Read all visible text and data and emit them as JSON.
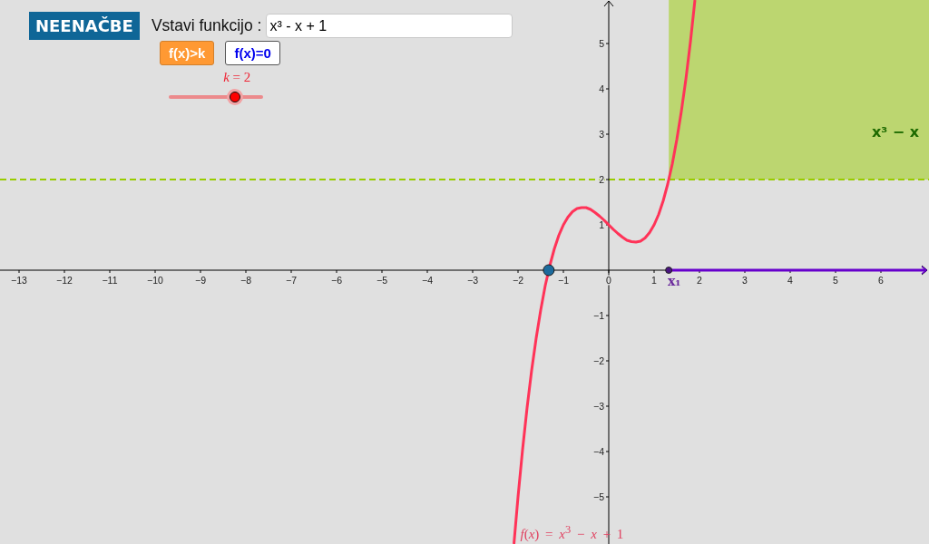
{
  "header": {
    "title": "NEENAČBE",
    "input_label": "Vstavi funkcijo :",
    "input_value": "x³ - x + 1"
  },
  "buttons": [
    {
      "label": "f(x)>k",
      "selected": true
    },
    {
      "label": "f(x)=0",
      "selected": false
    }
  ],
  "slider": {
    "label": "*k* = 2",
    "level": 0.7
  },
  "graph": {
    "chart_data": {
      "type": "line",
      "x": [
        -2.09,
        -2.0,
        -1.9,
        -1.8,
        -1.7,
        -1.6,
        -1.5,
        -1.4,
        -1.3,
        -1.2,
        -1.1,
        -1.0,
        -0.9,
        -0.8,
        -0.7,
        -0.6,
        -0.5,
        -0.4,
        -0.3,
        -0.2,
        -0.1,
        0,
        0.1,
        0.2,
        0.3,
        0.4,
        0.5,
        0.6,
        0.7,
        0.8,
        0.9,
        1.0,
        1.1,
        1.2,
        1.3,
        1.4,
        1.5,
        1.6,
        1.7,
        1.8,
        1.9
      ],
      "series": [
        {
          "name": "*f*(*x*) = *x*$^{3}$ − *x* + 1",
          "color": "#ff3358",
          "values": [
            -6.04,
            -5,
            -3.96,
            -3.03,
            -2.21,
            -1.5,
            -0.88,
            -0.34,
            0.1,
            0.47,
            0.77,
            1,
            1.17,
            1.29,
            1.36,
            1.38,
            1.38,
            1.34,
            1.27,
            1.19,
            1.1,
            1,
            0.9,
            0.81,
            0.73,
            0.66,
            0.63,
            0.62,
            0.64,
            0.71,
            0.83,
            1,
            1.23,
            1.53,
            1.9,
            2.34,
            2.88,
            3.5,
            4.21,
            5.03,
            5.96
          ]
        }
      ],
      "xlim": [
        -13.42,
        7.06
      ],
      "ylim": [
        -6.04,
        5.96
      ],
      "xticks": [
        {
          "value": -13,
          "label": "−13"
        },
        {
          "value": -12,
          "label": "−12"
        },
        {
          "value": -11,
          "label": "−11"
        },
        {
          "value": -10,
          "label": "−10"
        },
        {
          "value": -9,
          "label": "−9"
        },
        {
          "value": -8,
          "label": "−8"
        },
        {
          "value": -7,
          "label": "−7"
        },
        {
          "value": -6,
          "label": "−6"
        },
        {
          "value": -5,
          "label": "−5"
        },
        {
          "value": -4,
          "label": "−4"
        },
        {
          "value": -3,
          "label": "−3"
        },
        {
          "value": -2,
          "label": "−2"
        },
        {
          "value": -1,
          "label": "−1"
        },
        0,
        1,
        2,
        3,
        4,
        5,
        6
      ],
      "yticks": [
        {
          "value": -5,
          "label": "−5"
        },
        {
          "value": -4,
          "label": "−4"
        },
        {
          "value": -3,
          "label": "−3"
        },
        {
          "value": -2,
          "label": "−2"
        },
        {
          "value": -1,
          "label": "−1"
        },
        1,
        2,
        3,
        4,
        5
      ],
      "ref_lines": [
        {
          "axis": "y",
          "value": 2
        }
      ],
      "bands": [
        {
          "axis": "y",
          "from": 2,
          "to": 5.96,
          "label": "x³ − x"
        }
      ],
      "annotations": [
        "x₁"
      ]
    }
  }
}
